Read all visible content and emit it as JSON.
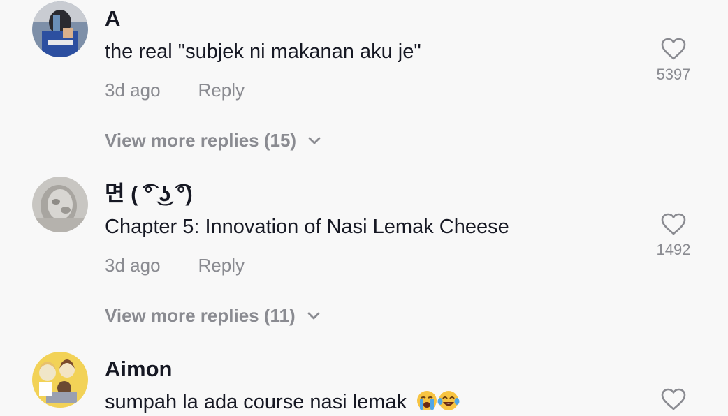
{
  "comments": [
    {
      "username": "A",
      "text": "the real \"subjek ni makanan aku je\"",
      "time": "3d ago",
      "reply_label": "Reply",
      "likes": "5397",
      "view_more": "View more replies (15)",
      "icon": "heart-outline-icon"
    },
    {
      "username": "면 ( ͡° ͜ʖ ͡°)",
      "text": "Chapter 5: Innovation of Nasi Lemak Cheese",
      "time": "3d ago",
      "reply_label": "Reply",
      "likes": "1492",
      "view_more": "View more replies (11)",
      "icon": "heart-outline-icon"
    },
    {
      "username": "Aimon",
      "text": "sumpah la ada course nasi lemak",
      "emojis": [
        "loudly-crying-face",
        "face-with-tears-of-joy"
      ],
      "icon": "heart-outline-icon"
    }
  ],
  "colors": {
    "background": "#f8f8f8",
    "primary_text": "#161823",
    "secondary_text": "#8a8b91"
  }
}
